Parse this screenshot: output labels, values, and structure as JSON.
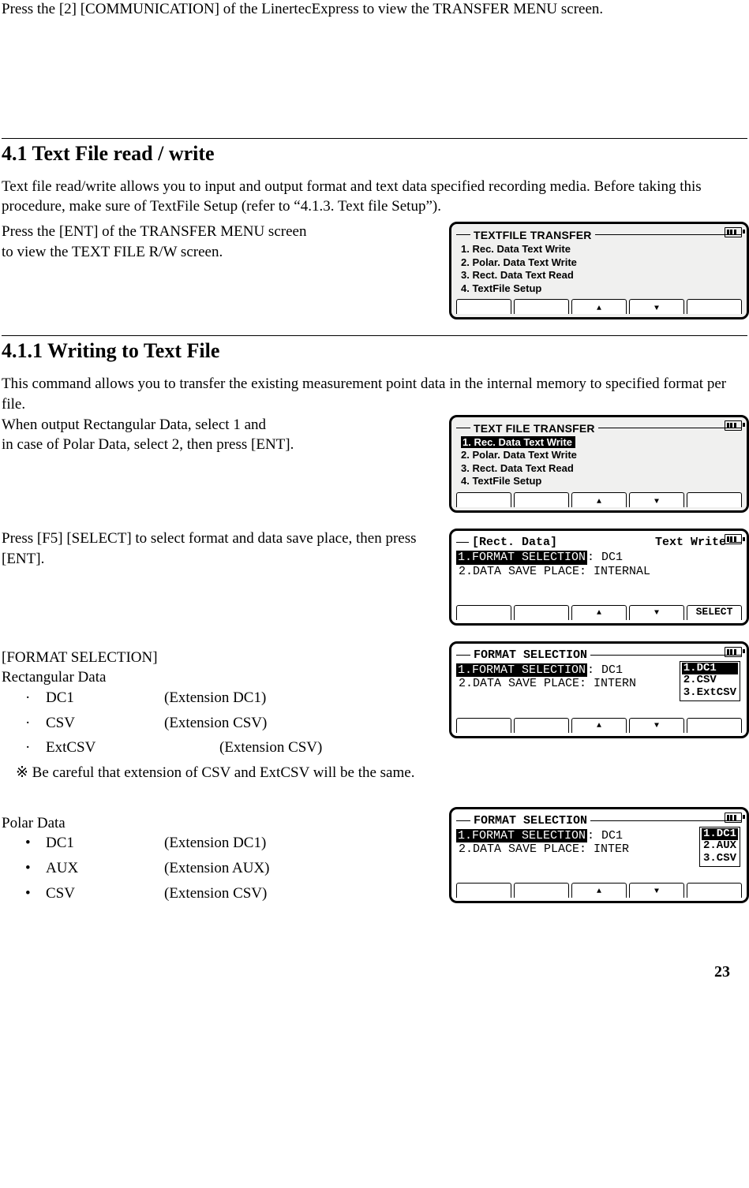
{
  "intro": "Press the [2] [COMMUNICATION] of the LinertecExpress to view the TRANSFER MENU screen.",
  "sec41": {
    "title": "4.1 Text File read / write",
    "p1": "Text file read/write allows you to input and output format and text data specified recording media. Before taking this procedure, make sure of TextFile Setup (refer to “4.1.3. Text file Setup”).",
    "p2a": "Press the [ENT] of the TRANSFER MENU screen",
    "p2b": "to view the TEXT FILE R/W screen.",
    "lcd": {
      "title": "TEXTFILE TRANSFER",
      "items": [
        "1.  Rec. Data Text Write",
        "2.  Polar. Data Text Write",
        "3.  Rect. Data Text Read",
        "4.  TextFile Setup"
      ]
    }
  },
  "sec411": {
    "title": "4.1.1 Writing to Text File",
    "p1": "This command allows you to transfer the existing measurement point data in the internal memory to specified format per file.",
    "p2a": "When output Rectangular Data, select 1 and",
    "p2b": "in case of Polar Data, select 2, then press [ENT].",
    "lcd1": {
      "title": "TEXT FILE TRANSFER",
      "items": [
        "1.  Rec. Data Text Write",
        "2.  Polar. Data Text Write",
        "3.  Rect. Data Text Read",
        "4.  TextFile Setup"
      ]
    },
    "p3": "Press [F5] [SELECT] to select format and data save place, then press [ENT].",
    "lcd2": {
      "title_left": "[Rect. Data]",
      "title_right": "Text Write",
      "r1a": "1.FORMAT SELECTION",
      "r1b": ": DC1",
      "r2a": "2.DATA SAVE PLACE ",
      "r2b": ": INTERNAL",
      "select_label": "SELECT"
    },
    "fmt_heading": "[FORMAT SELECTION]",
    "rect_heading": "Rectangular Data",
    "rect_items": [
      {
        "name": "DC1",
        "ext": "(Extension DC1)"
      },
      {
        "name": "CSV",
        "ext": "(Extension CSV)"
      },
      {
        "name": "ExtCSV",
        "ext": "(Extension CSV)"
      }
    ],
    "note": "※  Be careful that extension of CSV and ExtCSV will be the same.",
    "lcd3": {
      "title": "FORMAT SELECTION",
      "r1a": "1.FORMAT SELECTION",
      "r1b": ": DC1",
      "r2a": "2.DATA SAVE PLACE ",
      "r2b": ": INTERN",
      "popup": [
        "1.DC1",
        "2.CSV",
        "3.ExtCSV"
      ]
    },
    "polar_heading": "Polar Data",
    "polar_items": [
      {
        "name": "DC1",
        "ext": "(Extension DC1)"
      },
      {
        "name": "AUX",
        "ext": "(Extension AUX)"
      },
      {
        "name": "CSV",
        "ext": "(Extension CSV)"
      }
    ],
    "lcd4": {
      "title": "FORMAT SELECTION",
      "r1a": "1.FORMAT SELECTION",
      "r1b": ": DC1",
      "r2a": "2.DATA SAVE PLACE ",
      "r2b": ": INTER",
      "popup": [
        "1.DC1",
        "2.AUX",
        "3.CSV"
      ]
    }
  },
  "page_number": "23",
  "bullets": {
    "dot": "·",
    "bullet": "•"
  }
}
